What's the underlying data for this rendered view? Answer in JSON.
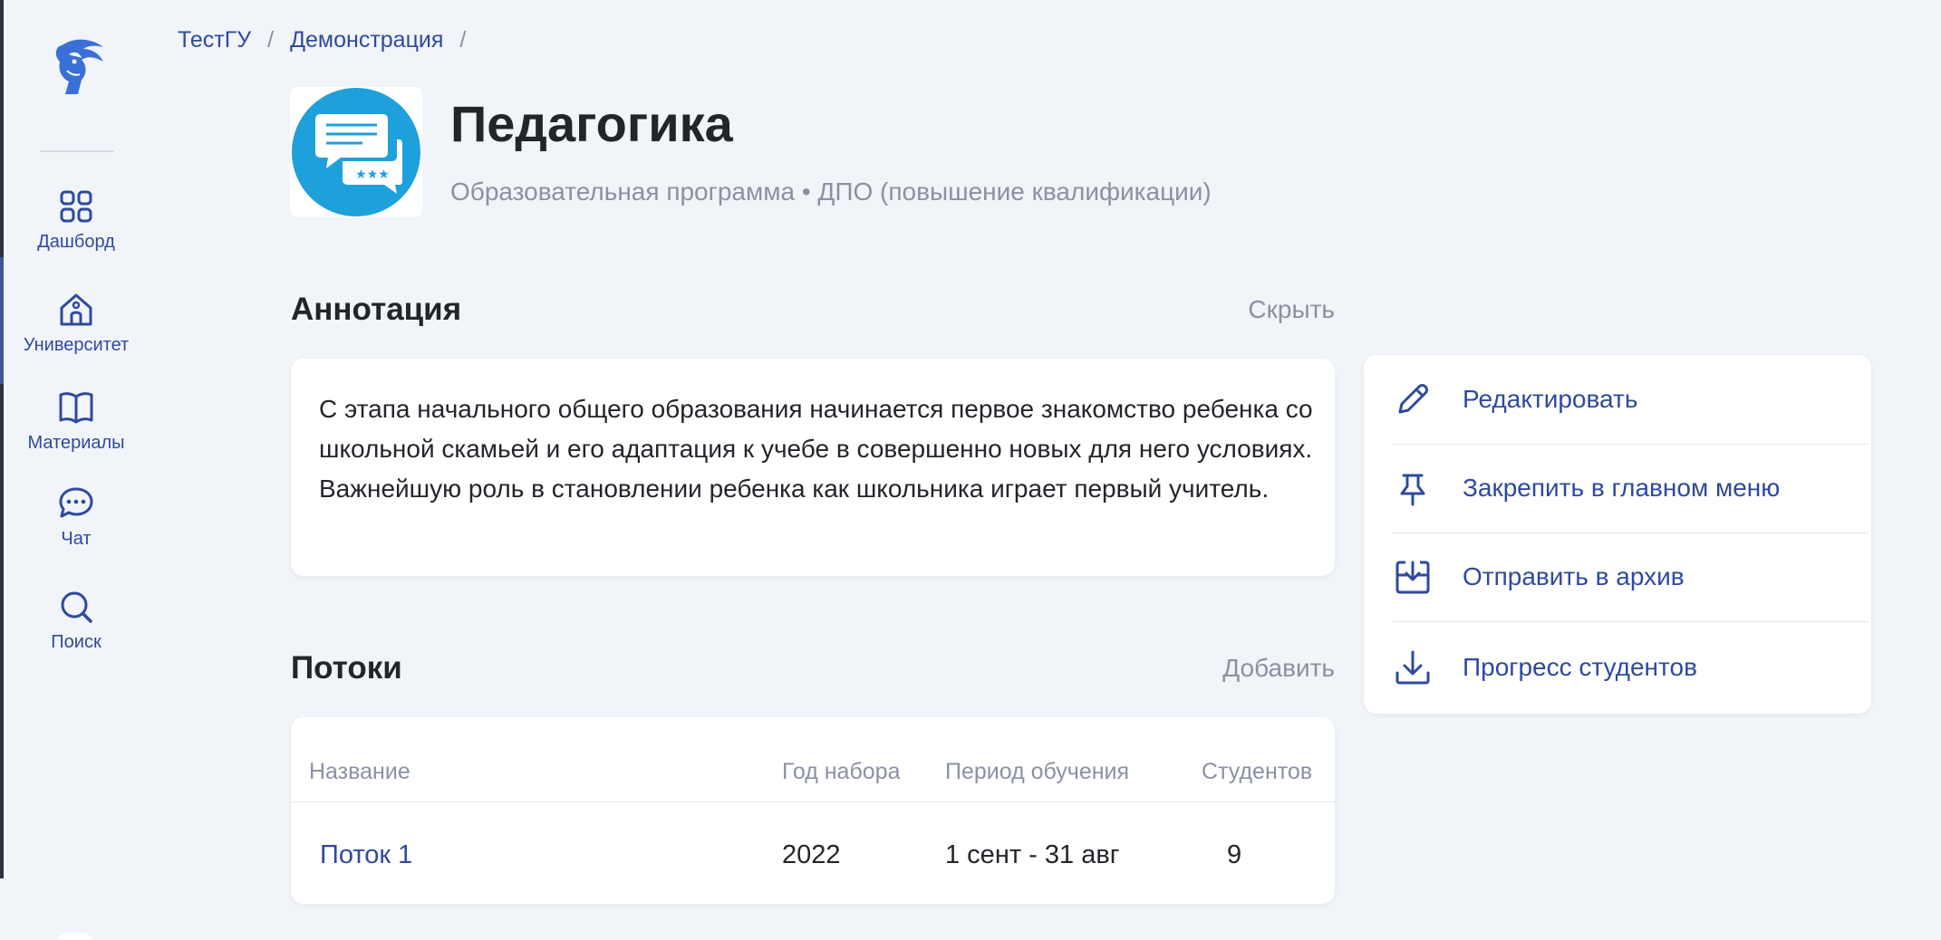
{
  "breadcrumb": {
    "items": [
      "ТестГУ",
      "Демонстрация"
    ],
    "separator": "/"
  },
  "sidebar": {
    "items": [
      {
        "label": "Дашборд",
        "icon": "grid-icon"
      },
      {
        "label": "Университет",
        "icon": "university-icon"
      },
      {
        "label": "Материалы",
        "icon": "book-icon"
      },
      {
        "label": "Чат",
        "icon": "chat-icon"
      },
      {
        "label": "Поиск",
        "icon": "search-icon"
      }
    ]
  },
  "header": {
    "title": "Педагогика",
    "subtitle": "Образовательная программа • ДПО (повышение квалификации)"
  },
  "annotation": {
    "title": "Аннотация",
    "action": "Скрыть",
    "text": "С этапа начального общего образования начинается первое знакомство ребенка со школьной скамьей и его адаптация к учебе в совершенно новых для него условиях. Важнейшую роль в становлении ребенка как школьника играет первый учитель."
  },
  "actions": [
    {
      "label": "Редактировать",
      "icon": "pencil-icon"
    },
    {
      "label": "Закрепить в главном меню",
      "icon": "pin-icon"
    },
    {
      "label": "Отправить в архив",
      "icon": "archive-icon"
    },
    {
      "label": "Прогресс студентов",
      "icon": "download-icon"
    }
  ],
  "streams": {
    "title": "Потоки",
    "action": "Добавить",
    "columns": [
      "Название",
      "Год набора",
      "Период обучения",
      "Студентов"
    ],
    "rows": [
      {
        "name": "Поток 1",
        "year": "2022",
        "period": "1 сент - 31 авг",
        "students": "9"
      }
    ]
  },
  "colors": {
    "accent": "#2e4a9e",
    "background": "#f1f4f8",
    "muted": "#8b91a3",
    "icon_circle": "#1ea0db"
  }
}
